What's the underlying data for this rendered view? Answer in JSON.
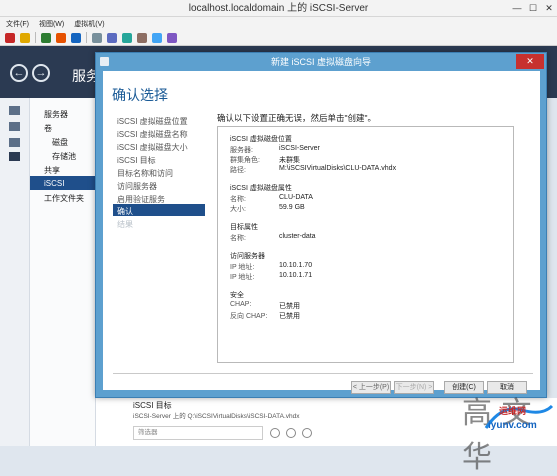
{
  "vm": {
    "window_title": "localhost.localdomain 上的 iSCSI-Server",
    "menus": [
      "文件(F)",
      "视图(W)",
      "虚拟机(V)"
    ]
  },
  "server_manager": {
    "title": "服务",
    "nav": [
      "服务器",
      "卷",
      "磁盘",
      "存储池",
      "共享",
      "iSCSI",
      "工作文件夹"
    ]
  },
  "dialog": {
    "title": "新建 iSCSI 虚拟磁盘向导",
    "heading": "确认选择",
    "close_glyph": "✕",
    "steps": [
      "iSCSI 虚拟磁盘位置",
      "iSCSI 虚拟磁盘名称",
      "iSCSI 虚拟磁盘大小",
      "iSCSI 目标",
      "目标名称和访问",
      "访问服务器",
      "启用验证服务",
      "确认",
      "结果"
    ],
    "intro": "确认以下设置正确无误，然后单击\"创建\"。",
    "summary": {
      "location_title": "iSCSI 虚拟磁盘位置",
      "server_label": "服务器:",
      "server_value": "iSCSI-Server",
      "cluster_label": "群集角色:",
      "cluster_value": "未群集",
      "path_label": "路径:",
      "path_value": "M:\\iSCSIVirtualDisks\\CLU-DATA.vhdx",
      "props_title": "iSCSI 虚拟磁盘属性",
      "name_label": "名称:",
      "name_value": "CLU-DATA",
      "size_label": "大小:",
      "size_value": "59.9 GB",
      "target_title": "目标属性",
      "tname_label": "名称:",
      "tname_value": "cluster-data",
      "access_title": "访问服务器",
      "ip1_label": "IP 地址:",
      "ip1_value": "10.10.1.70",
      "ip2_label": "IP 地址:",
      "ip2_value": "10.10.1.71",
      "security_title": "安全",
      "chap_label": "CHAP:",
      "chap_value": "已禁用",
      "rchap_label": "反向 CHAP:",
      "rchap_value": "已禁用"
    },
    "buttons": {
      "prev": "< 上一步(P)",
      "next": "下一步(N) >",
      "create": "创建(C)",
      "cancel": "取消"
    }
  },
  "bottom": {
    "heading": "iSCSI 目标",
    "subtext": "iSCSI-Server 上的 Q:\\iSCSIVirtualDisks\\iSCSI-DATA.vhdx",
    "filter_placeholder": "筛选器"
  },
  "watermark": {
    "big": "高 文 华",
    "red": "运维网",
    "site": "iyunv.com"
  }
}
